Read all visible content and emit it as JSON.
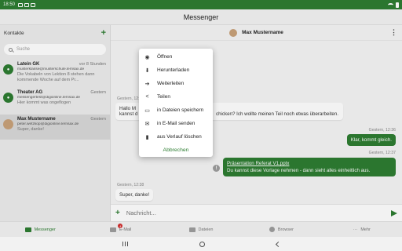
{
  "statusbar": {
    "time": "18:50"
  },
  "app": {
    "title": "Messenger"
  },
  "contacts": {
    "header": "Kontakte",
    "search_placeholder": "Suche",
    "items": [
      {
        "name": "Latein GK",
        "time": "vor 8 Stunden",
        "email": "musterklasse@musterschule.lernsax.de",
        "preview": "Die Vokabeln von Lektion 8 stehen dann kommende Woche auf dem Pr..."
      },
      {
        "name": "Theater AG",
        "time": "Gestern",
        "email": "messengertest@digionline.lernsax.de",
        "preview": "Hier kommt was ongeflogen"
      },
      {
        "name": "Max Mustername",
        "time": "Gestern",
        "email": "peter.wetzkop@digionline.lernsax.de",
        "preview": "Super, danke!"
      }
    ]
  },
  "chat": {
    "partner": "Max Mustername",
    "messages": [
      {
        "time": "Gestern, 12:36",
        "text_left": "Hallo M",
        "text_left2": "kannst d",
        "text_right": "chicken? Ich wollte meinen Teil noch etwas überarbeiten."
      },
      {
        "time": "Gestern, 12:36",
        "text": "Klar, kommt gleich."
      },
      {
        "time": "Gestern, 12:37",
        "link": "Präsentation Referat V1.pptx",
        "text": "Du kannst diese Vorlage nehmen - dann sieht alles einheitlich aus."
      },
      {
        "time": "Gestern, 12:38",
        "text": "Super, danke!"
      }
    ],
    "input_placeholder": "Nachricht..."
  },
  "context_menu": {
    "items": [
      {
        "icon": "eye-icon",
        "label": "Öffnen"
      },
      {
        "icon": "download-icon",
        "label": "Herunterladen"
      },
      {
        "icon": "forward-icon",
        "label": "Weiterleiten"
      },
      {
        "icon": "share-icon",
        "label": "Teilen"
      },
      {
        "icon": "folder-icon",
        "label": "in Dateien speichern"
      },
      {
        "icon": "mail-icon",
        "label": "in E-Mail senden"
      },
      {
        "icon": "trash-icon",
        "label": "aus Verlauf löschen"
      }
    ],
    "cancel": "Abbrechen"
  },
  "bottomnav": {
    "items": [
      {
        "label": "Messenger"
      },
      {
        "label": "E-Mail",
        "badge": "4"
      },
      {
        "label": "Dateien"
      },
      {
        "label": "Browser"
      },
      {
        "label": "Mehr"
      }
    ]
  },
  "colors": {
    "accent": "#2e7d32"
  }
}
